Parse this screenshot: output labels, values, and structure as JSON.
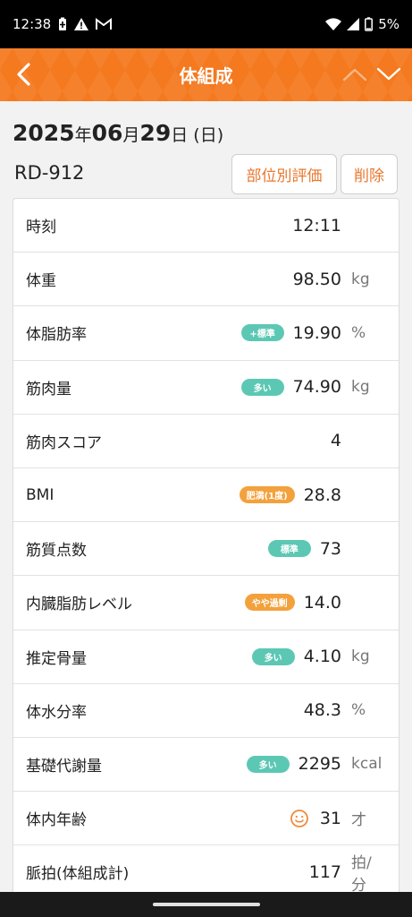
{
  "status": {
    "time": "12:38",
    "battery": "5%",
    "icons": [
      "battery-saver-icon",
      "alert-icon",
      "gmail-icon",
      "wifi-icon",
      "signal-icon",
      "battery-icon"
    ]
  },
  "appbar": {
    "title": "体組成",
    "icons": [
      "back-chevron-icon",
      "up-chevron-icon",
      "down-chevron-icon"
    ]
  },
  "record": {
    "date": {
      "year": "2025",
      "year_unit": "年",
      "month": "06",
      "month_unit": "月",
      "day": "29",
      "day_unit": "日",
      "weekday": "(日)"
    },
    "device": "RD-912"
  },
  "buttons": {
    "eval_label": "部位別評価",
    "delete_label": "削除"
  },
  "accent_color": "#f4791f",
  "rows": [
    {
      "label": "時刻",
      "badge": "",
      "value": "12:11",
      "unit": ""
    },
    {
      "label": "体重",
      "badge": "",
      "value": "98.50",
      "unit": "kg"
    },
    {
      "label": "体脂肪率",
      "badge": "+標準",
      "value": "19.90",
      "unit": "%"
    },
    {
      "label": "筋肉量",
      "badge": "多い",
      "value": "74.90",
      "unit": "kg"
    },
    {
      "label": "筋肉スコア",
      "badge": "",
      "value": "4",
      "unit": ""
    },
    {
      "label": "BMI",
      "badge": "肥満(1度)",
      "value": "28.8",
      "unit": ""
    },
    {
      "label": "筋質点数",
      "badge": "標準",
      "value": "73",
      "unit": ""
    },
    {
      "label": "内臓脂肪レベル",
      "badge": "やや過剰",
      "value": "14.0",
      "unit": ""
    },
    {
      "label": "推定骨量",
      "badge": "多い",
      "value": "4.10",
      "unit": "kg"
    },
    {
      "label": "体水分率",
      "badge": "",
      "value": "48.3",
      "unit": "%"
    },
    {
      "label": "基礎代謝量",
      "badge": "多い",
      "value": "2295",
      "unit": "kcal"
    },
    {
      "label": "体内年齢",
      "badge": "",
      "value": "31",
      "unit": "才"
    },
    {
      "label": "脈拍(体組成計)",
      "badge": "",
      "value": "117",
      "unit": "拍/分"
    }
  ]
}
